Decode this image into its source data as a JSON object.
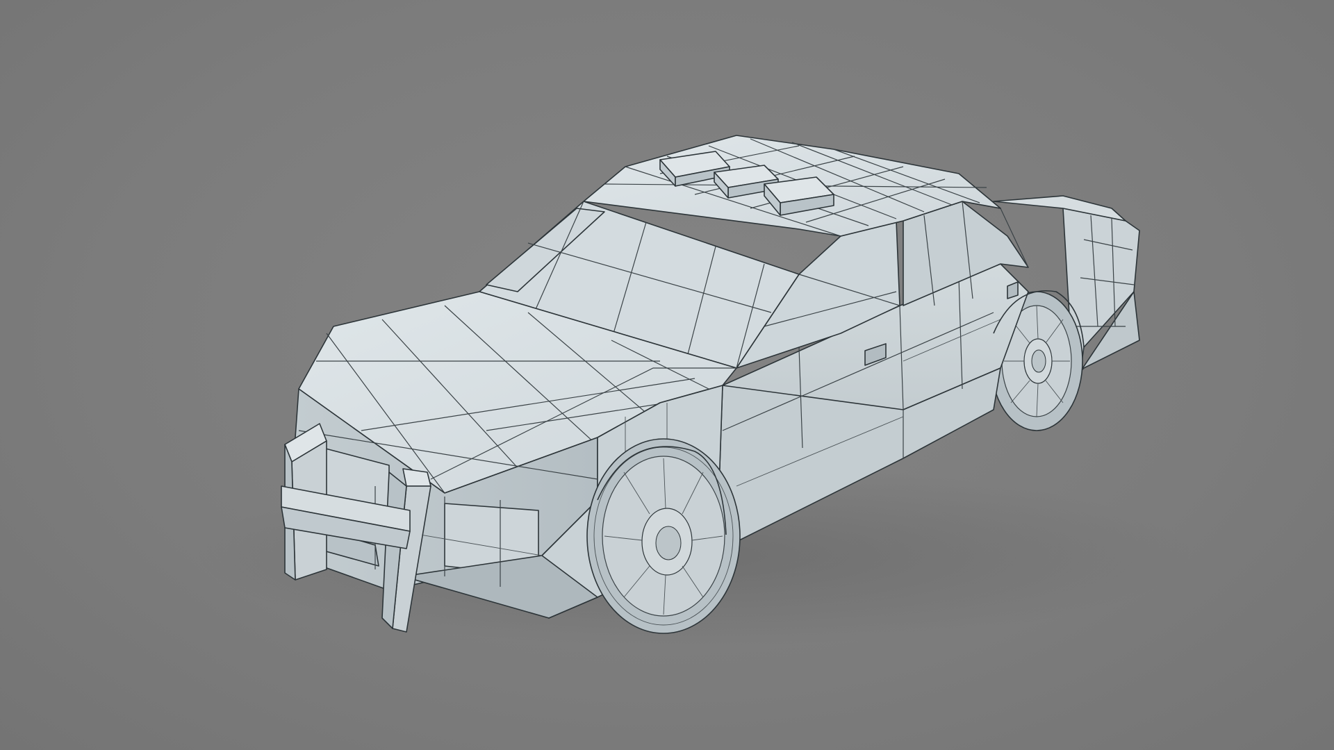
{
  "scene": {
    "subject": "low-poly-car-wireframe",
    "colors": {
      "background": "#7e7e7e",
      "body_light": "#d9e0e3",
      "body_mid": "#c8d0d4",
      "body_dark": "#a9b3b8",
      "wire": "#2c3438"
    }
  }
}
